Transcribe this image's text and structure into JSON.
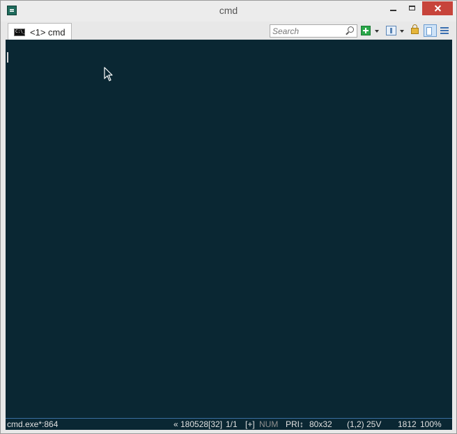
{
  "window": {
    "title": "cmd"
  },
  "tab": {
    "label": "<1> cmd",
    "icon": "console-icon",
    "icon_text": "C:\\_"
  },
  "search": {
    "placeholder": "Search"
  },
  "toolbar": {
    "icons": [
      "new-console-icon",
      "dropdown-caret-icon",
      "panel-view-icon",
      "dropdown-caret-icon",
      "lock-icon",
      "split-view-icon",
      "menu-icon"
    ]
  },
  "console": {
    "background": "#0a2733",
    "text": ""
  },
  "statusbar": {
    "process": "cmd.exe*:864",
    "buffer": "« 180528[32]",
    "page": "1/1",
    "plus": "[+]",
    "num": "NUM",
    "pri": "PRI↕",
    "size": "80x32",
    "cursor_pos": "(1,2) 25V",
    "pid": "1812",
    "zoom": "100%"
  },
  "colors": {
    "close_button": "#c7443b",
    "accent": "#3b6fa0",
    "console_bg": "#0a2733"
  }
}
